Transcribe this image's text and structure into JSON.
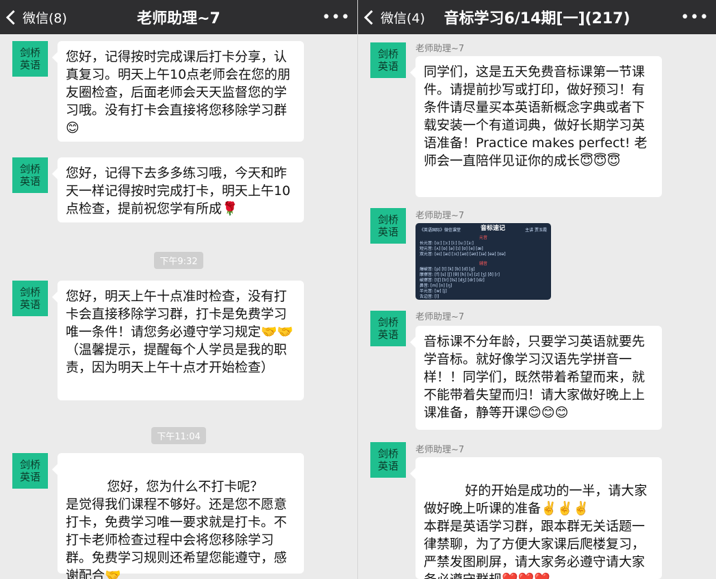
{
  "left": {
    "back_label": "微信(8)",
    "title": "老师助理~7",
    "more_label": "•••",
    "avatar_text": [
      "剑桥",
      "英语"
    ],
    "messages": [
      "您好，记得按时完成课后打卡分享，认真复习。明天上午10点老师会在您的朋友圈检查，后面老师会天天监督您的学习哦。没有打卡会直接将您移除学习群😊",
      "您好，记得下去多多练习哦，今天和昨天一样记得按时完成打卡，明天上午10点检查，提前祝您学有所成🌹",
      "您好，明天上午十点准时检查，没有打卡会直接移除学习群，打卡是免费学习唯一条件！请您务必遵守学习规定🤝🤝（温馨提示，提醒每个人学员是我的职责，因为明天上午十点才开始检查）",
      "您好，您为什么不打卡呢？\n是觉得我们课程不够好。还是您不愿意打卡，免费学习唯一要求就是打卡。不打卡老师检查过程中会将您移除学习群。免费学习规则还希望您能遵守，感谢配合🤝"
    ],
    "times": [
      "下午9:32",
      "下午11:04"
    ]
  },
  "right": {
    "back_label": "微信(4)",
    "title": "音标学习6/14期[一](217)",
    "more_label": "•••",
    "avatar_text": [
      "剑桥",
      "英语"
    ],
    "sender": "老师助理~7",
    "messages": [
      "同学们，这是五天免费音标课第一节课件。请提前抄写或打印，做好预习！有条件请尽量买本英语新概念字典或者下载安装一个有道词典，做好长期学习英语准备！Practice makes perfect! 老师会一直陪伴见证你的成长😇😇😇",
      "音标课不分年龄，只要学习英语就要先学音标。就好像学习汉语先学拼音一样！！同学们，既然带着希望而来，就不能带着失望而归！请大家做好晚上上课准备，静等开课😊😊😊",
      "好的开始是成功的一半，请大家做好晚上听课的准备✌️✌️✌️\n本群是英语学习群，跟本群无关话题一律禁聊，为了方便大家课后爬楼复习，严禁发图刷屏，请大家务必遵守请大家务必遵守群规❤️❤️❤️"
    ],
    "image_card": {
      "title": "音标速记",
      "left_tag": "《英语国际》微信课堂",
      "right_tag": "主讲 贾玉霞",
      "red_1": "元音",
      "red_2": "辅音",
      "lines": [
        "长元音: [ɑː] [ɔː] [iː] [uː] [ɜː]",
        "短元音: [ʌ] [ɒ] [ə] [ɪ] [ʊ] [e] [æ]",
        "双元音: [eɪ] [aɪ] [ɔɪ] [aʊ] [əʊ] [ɪə] [eə] [ʊə]",
        "爆破音: [p] [t] [k] [b] [d] [g]",
        "摩擦音: [f] [s] [ʃ] [θ] [h] [v] [z] [ʒ] [ð] [r]",
        "破擦音: [tʃ] [tr] [ts] [dʒ] [dr] [dz]",
        "鼻音: [m] [n] [ŋ]",
        "半元音: [w] [j]",
        "舌边音: [l]"
      ]
    }
  }
}
